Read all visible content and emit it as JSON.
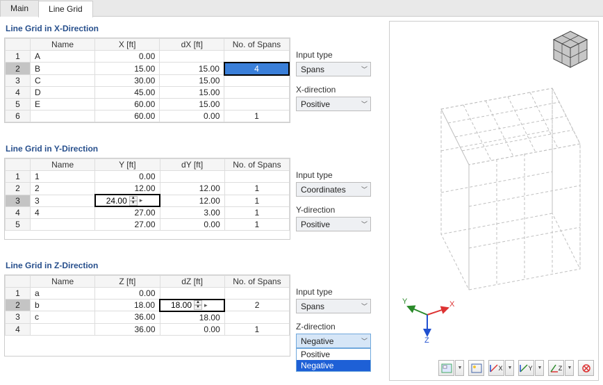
{
  "tabs": {
    "main": "Main",
    "lineGrid": "Line Grid"
  },
  "sectionX": {
    "title": "Line Grid in X-Direction",
    "headers": {
      "name": "Name",
      "coord": "X [ft]",
      "delta": "dX [ft]",
      "spans": "No. of Spans"
    },
    "rows": [
      {
        "idx": "1",
        "name": "A",
        "coord": "0.00",
        "delta": "",
        "spans": ""
      },
      {
        "idx": "2",
        "name": "B",
        "coord": "15.00",
        "delta": "15.00",
        "spans": "4"
      },
      {
        "idx": "3",
        "name": "C",
        "coord": "30.00",
        "delta": "15.00",
        "spans": ""
      },
      {
        "idx": "4",
        "name": "D",
        "coord": "45.00",
        "delta": "15.00",
        "spans": ""
      },
      {
        "idx": "5",
        "name": "E",
        "coord": "60.00",
        "delta": "15.00",
        "spans": ""
      },
      {
        "idx": "6",
        "name": "",
        "coord": "60.00",
        "delta": "0.00",
        "spans": "1"
      }
    ],
    "inputTypeLabel": "Input type",
    "inputType": "Spans",
    "dirLabel": "X-direction",
    "dir": "Positive"
  },
  "sectionY": {
    "title": "Line Grid in Y-Direction",
    "headers": {
      "name": "Name",
      "coord": "Y [ft]",
      "delta": "dY [ft]",
      "spans": "No. of Spans"
    },
    "rows": [
      {
        "idx": "1",
        "name": "1",
        "coord": "0.00",
        "delta": "",
        "spans": ""
      },
      {
        "idx": "2",
        "name": "2",
        "coord": "12.00",
        "delta": "12.00",
        "spans": "1"
      },
      {
        "idx": "3",
        "name": "3",
        "coord": "24.00",
        "delta": "12.00",
        "spans": "1"
      },
      {
        "idx": "4",
        "name": "4",
        "coord": "27.00",
        "delta": "3.00",
        "spans": "1"
      },
      {
        "idx": "5",
        "name": "",
        "coord": "27.00",
        "delta": "0.00",
        "spans": "1"
      }
    ],
    "activeRow": "3",
    "activeValue": "24.00",
    "inputTypeLabel": "Input type",
    "inputType": "Coordinates",
    "dirLabel": "Y-direction",
    "dir": "Positive"
  },
  "sectionZ": {
    "title": "Line Grid in Z-Direction",
    "headers": {
      "name": "Name",
      "coord": "Z [ft]",
      "delta": "dZ [ft]",
      "spans": "No. of Spans"
    },
    "rows": [
      {
        "idx": "1",
        "name": "a",
        "coord": "0.00",
        "delta": "",
        "spans": ""
      },
      {
        "idx": "2",
        "name": "b",
        "coord": "18.00",
        "delta": "18.00",
        "spans": "2"
      },
      {
        "idx": "3",
        "name": "c",
        "coord": "36.00",
        "delta": "18.00",
        "spans": ""
      },
      {
        "idx": "4",
        "name": "",
        "coord": "36.00",
        "delta": "0.00",
        "spans": "1"
      }
    ],
    "activeRow": "2",
    "activeValue": "18.00",
    "inputTypeLabel": "Input type",
    "inputType": "Spans",
    "dirLabel": "Z-direction",
    "dir": "Negative",
    "dropdown": {
      "opt1": "Positive",
      "opt2": "Negative"
    }
  },
  "axes": {
    "x": "X",
    "y": "Y",
    "z": "Z"
  },
  "toolbar": {
    "x": "X",
    "y": "Y",
    "z": "Z"
  }
}
